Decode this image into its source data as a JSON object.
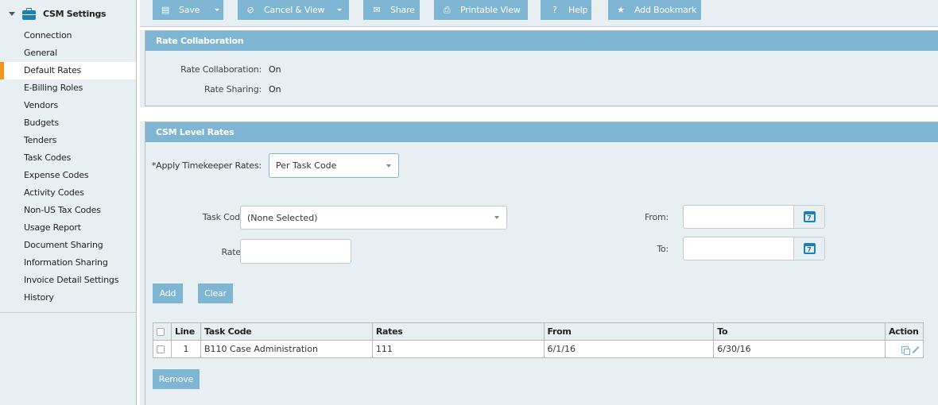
{
  "sidebar": {
    "title": "CSM Settings",
    "items": [
      {
        "label": "Connection"
      },
      {
        "label": "General"
      },
      {
        "label": "Default Rates",
        "active": true
      },
      {
        "label": "E-Billing Roles"
      },
      {
        "label": "Vendors"
      },
      {
        "label": "Budgets"
      },
      {
        "label": "Tenders"
      },
      {
        "label": "Task Codes"
      },
      {
        "label": "Expense Codes"
      },
      {
        "label": "Activity Codes"
      },
      {
        "label": "Non-US Tax Codes"
      },
      {
        "label": "Usage Report"
      },
      {
        "label": "Document Sharing"
      },
      {
        "label": "Information Sharing"
      },
      {
        "label": "Invoice Detail Settings"
      },
      {
        "label": "History"
      }
    ]
  },
  "toolbar": {
    "save": "Save",
    "cancel_view": "Cancel & View",
    "share": "Share",
    "printable_view": "Printable View",
    "help": "Help",
    "add_bookmark": "Add Bookmark"
  },
  "rate_collaboration": {
    "title": "Rate Collaboration",
    "collab_label": "Rate Collaboration:",
    "collab_value": "On",
    "sharing_label": "Rate Sharing:",
    "sharing_value": "On"
  },
  "csm_rates": {
    "title": "CSM Level Rates",
    "apply_label": "*Apply Timekeeper Rates:",
    "apply_value": "Per Task Code",
    "task_code_label": "Task Code:",
    "task_code_value": "(None Selected)",
    "rates_label": "Rates:",
    "rates_value": "",
    "from_label": "From:",
    "from_value": "",
    "to_label": "To:",
    "to_value": "",
    "calendar_day": "7",
    "add_button": "Add",
    "clear_button": "Clear",
    "remove_button": "Remove",
    "table": {
      "headers": {
        "line": "Line",
        "task_code": "Task Code",
        "rates": "Rates",
        "from": "From",
        "to": "To",
        "action": "Action"
      },
      "rows": [
        {
          "line": "1",
          "task_code": "B110 Case Administration",
          "rates": "111",
          "from": "6/1/16",
          "to": "6/30/16"
        }
      ]
    }
  }
}
